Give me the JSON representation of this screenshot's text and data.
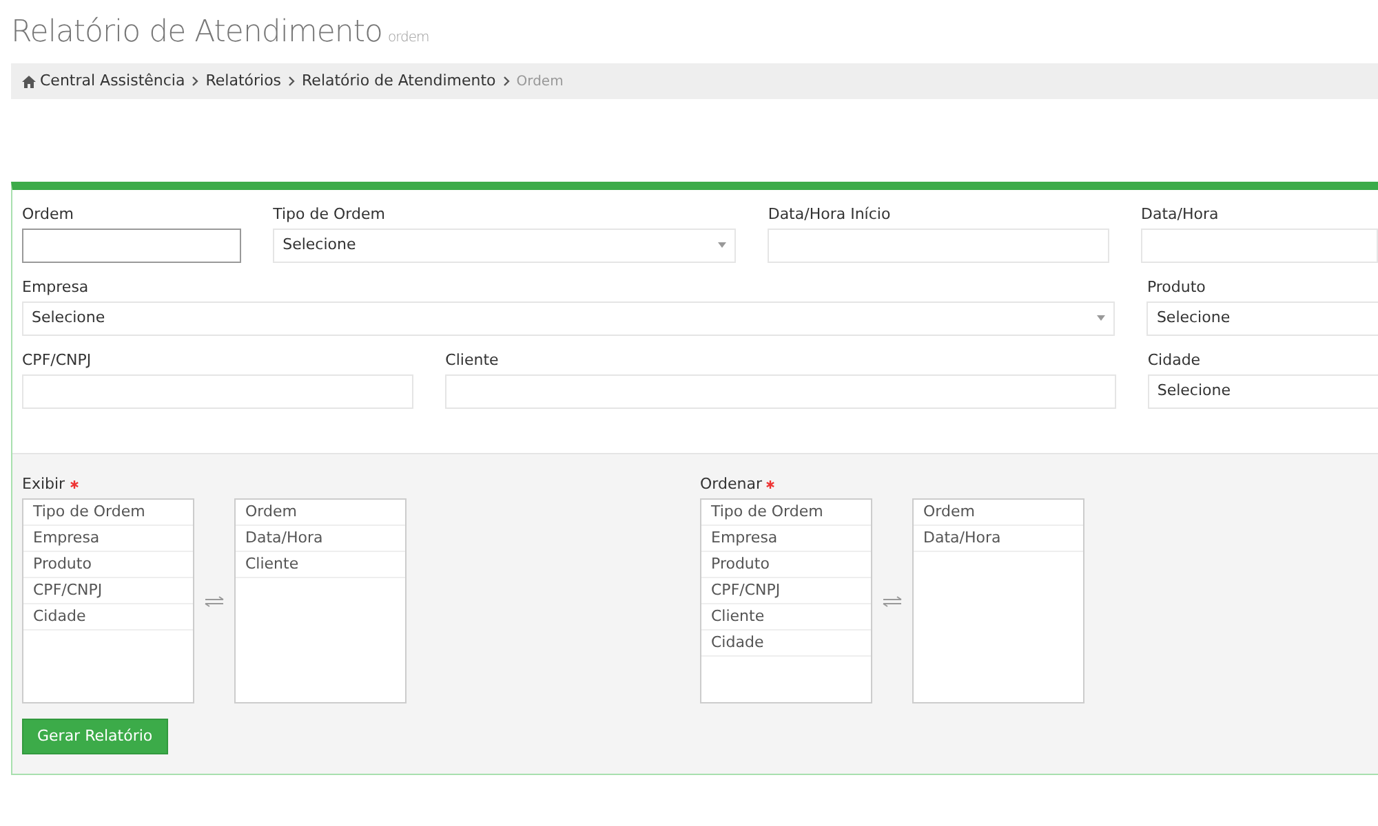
{
  "page": {
    "title": "Relatório de Atendimento",
    "subtitle": "ordem"
  },
  "breadcrumb": [
    {
      "label": "Central Assistência",
      "home": true,
      "current": false
    },
    {
      "label": "Relatórios",
      "home": false,
      "current": false
    },
    {
      "label": "Relatório de Atendimento",
      "home": false,
      "current": false
    },
    {
      "label": "Ordem",
      "home": false,
      "current": true
    }
  ],
  "filter_rows": [
    [
      {
        "label": "Ordem",
        "kind": "input",
        "focused": true
      },
      {
        "label": "Tipo de Ordem",
        "kind": "select",
        "value": "Selecione"
      },
      {
        "label": "Data/Hora Início",
        "kind": "input",
        "focused": false
      },
      {
        "label": "Data/Hora",
        "kind": "input",
        "focused": false
      }
    ],
    [
      {
        "label": "Empresa",
        "kind": "select",
        "value": "Selecione"
      },
      {
        "label": "Produto",
        "kind": "select",
        "value": "Selecione"
      }
    ],
    [
      {
        "label": "CPF/CNPJ",
        "kind": "input",
        "focused": false
      },
      {
        "label": "Cliente",
        "kind": "input",
        "focused": false
      },
      {
        "label": "Cidade",
        "kind": "select",
        "value": "Selecione"
      }
    ]
  ],
  "pickers": [
    {
      "label": "Exibir",
      "required": true,
      "available": [
        "Tipo de Ordem",
        "Empresa",
        "Produto",
        "CPF/CNPJ",
        "Cidade"
      ],
      "chosen": [
        "Ordem",
        "Data/Hora",
        "Cliente"
      ]
    },
    {
      "label": "Ordenar",
      "required": true,
      "available": [
        "Tipo de Ordem",
        "Empresa",
        "Produto",
        "CPF/CNPJ",
        "Cliente",
        "Cidade"
      ],
      "chosen": [
        "Ordem",
        "Data/Hora"
      ]
    }
  ],
  "submit_button": "Gerar Relatório"
}
